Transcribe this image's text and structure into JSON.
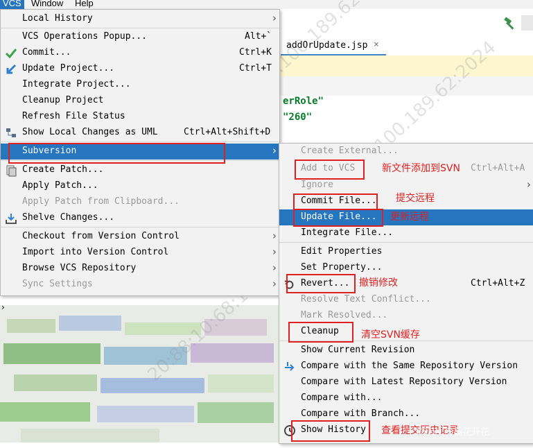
{
  "menubar": {
    "vcs": "VCS",
    "window": "Window",
    "help": "Help"
  },
  "editor": {
    "tab_title": "addOrUpdate.jsp",
    "tab_close": "×",
    "code_line_1": "erRole\"",
    "code_line_2": "\"260\""
  },
  "vcs_menu": {
    "items": [
      {
        "label": "Local History",
        "submenu": true
      },
      {
        "label": "VCS Operations Popup...",
        "shortcut": "Alt+`"
      },
      {
        "label": "Commit...",
        "shortcut": "Ctrl+K"
      },
      {
        "label": "Update Project...",
        "shortcut": "Ctrl+T"
      },
      {
        "label": "Integrate Project..."
      },
      {
        "label": "Cleanup Project"
      },
      {
        "label": "Refresh File Status"
      },
      {
        "label": "Show Local Changes as UML",
        "shortcut": "Ctrl+Alt+Shift+D"
      },
      {
        "label": "Subversion",
        "submenu": true,
        "selected": true
      },
      {
        "label": "Create Patch..."
      },
      {
        "label": "Apply Patch..."
      },
      {
        "label": "Apply Patch from Clipboard...",
        "disabled": true
      },
      {
        "label": "Shelve Changes..."
      },
      {
        "label": "Checkout from Version Control",
        "submenu": true
      },
      {
        "label": "Import into Version Control",
        "submenu": true
      },
      {
        "label": "Browse VCS Repository",
        "submenu": true
      },
      {
        "label": "Sync Settings",
        "submenu": true,
        "disabled": true
      }
    ]
  },
  "subversion_menu": {
    "items": [
      {
        "label": "Create External...",
        "disabled": true
      },
      {
        "label": "Add to VCS",
        "shortcut": "Ctrl+Alt+A",
        "disabled": true
      },
      {
        "label": "Ignore",
        "submenu": true,
        "disabled": true
      },
      {
        "label": "Commit File..."
      },
      {
        "label": "Update File...",
        "selected": true
      },
      {
        "label": "Integrate File..."
      },
      {
        "label": "Edit Properties"
      },
      {
        "label": "Set Property..."
      },
      {
        "label": "Revert...",
        "shortcut": "Ctrl+Alt+Z"
      },
      {
        "label": "Resolve Text Conflict...",
        "disabled": true
      },
      {
        "label": "Mark Resolved...",
        "disabled": true
      },
      {
        "label": "Cleanup"
      },
      {
        "label": "Show Current Revision"
      },
      {
        "label": "Compare with the Same Repository Version"
      },
      {
        "label": "Compare with Latest Repository Version"
      },
      {
        "label": "Compare with..."
      },
      {
        "label": "Compare with Branch..."
      },
      {
        "label": "Show History"
      }
    ]
  },
  "annotations": {
    "add_to_svn": "新文件添加到SVN",
    "commit_remote": "提交远程",
    "update_remote": "更新远程",
    "revert_changes": "撤销修改",
    "clear_svn_cache": "清空SVN缓存",
    "view_history": "查看提交历史记录"
  },
  "watermark": {
    "text": "20:88:10:68:150.100.189.62:2024"
  },
  "credit": "CSDN @桑花开花",
  "colors": {
    "selection": "#2675bf",
    "menu_bg": "#f2f2f2",
    "annotation": "#e02020",
    "disabled": "#9a9a9a"
  }
}
